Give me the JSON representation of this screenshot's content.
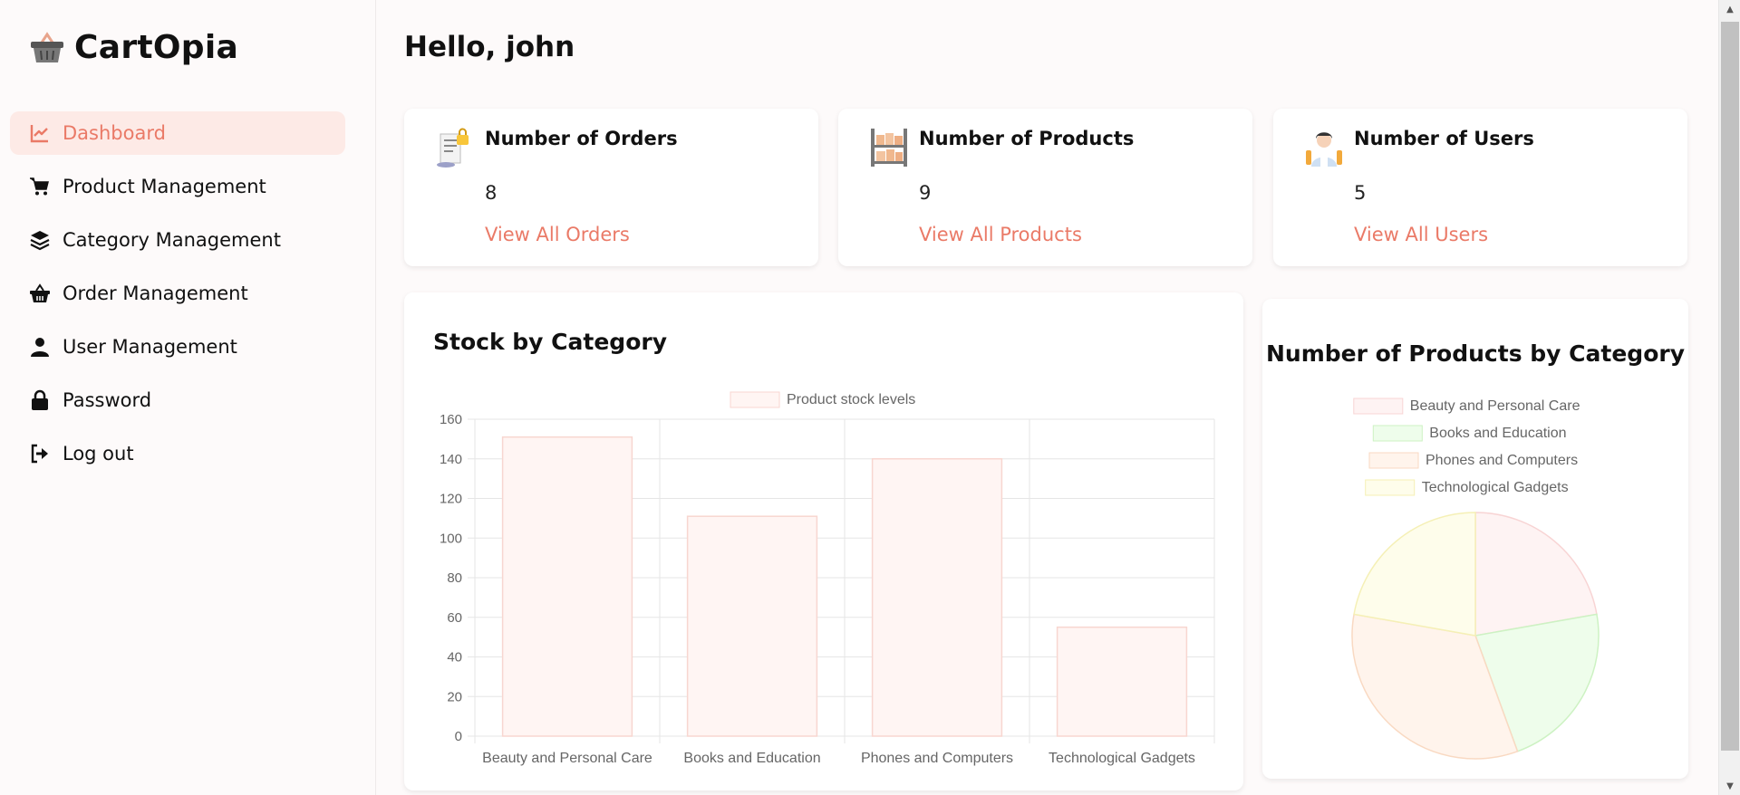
{
  "app": {
    "name": "CartOpia",
    "logo_icon": "basket-icon",
    "brand_color": "#ea7a67"
  },
  "sidebar": {
    "items": [
      {
        "label": "Dashboard",
        "icon": "chart-line-icon",
        "active": true
      },
      {
        "label": "Product Management",
        "icon": "cart-icon"
      },
      {
        "label": "Category Management",
        "icon": "layers-icon"
      },
      {
        "label": "Order Management",
        "icon": "basket-icon"
      },
      {
        "label": "User Management",
        "icon": "user-icon"
      },
      {
        "label": "Password",
        "icon": "lock-icon"
      },
      {
        "label": "Log out",
        "icon": "logout-icon"
      }
    ]
  },
  "header": {
    "greeting": "Hello, john"
  },
  "stats": [
    {
      "title": "Number of Orders",
      "value": "8",
      "link": "View All Orders",
      "icon": "order-receipt-icon"
    },
    {
      "title": "Number of Products",
      "value": "9",
      "link": "View All Products",
      "icon": "product-shelf-icon"
    },
    {
      "title": "Number of Users",
      "value": "5",
      "link": "View All Users",
      "icon": "users-icon"
    }
  ],
  "chart_data": [
    {
      "type": "bar",
      "title": "Stock by Category",
      "categories": [
        "Beauty and Personal Care",
        "Books and Education",
        "Phones and Computers",
        "Technological Gadgets"
      ],
      "series": [
        {
          "name": "Product stock levels",
          "values": [
            151,
            111,
            140,
            55
          ]
        }
      ],
      "ylim": [
        0,
        160
      ],
      "yticks": [
        0,
        20,
        40,
        60,
        80,
        100,
        120,
        140,
        160
      ],
      "grid": true,
      "legend": "top",
      "colors": {
        "fill": "#fff5f3",
        "stroke": "#f8d6d0"
      }
    },
    {
      "type": "pie",
      "title": "Number of Products by Category",
      "labels": [
        "Beauty and Personal Care",
        "Books and Education",
        "Phones and Computers",
        "Technological Gadgets"
      ],
      "values": [
        2,
        2,
        3,
        2
      ],
      "legend": "top",
      "colors": [
        {
          "fill": "#fef3f3",
          "stroke": "#f8d4d4"
        },
        {
          "fill": "#eefdeb",
          "stroke": "#cdf2c3"
        },
        {
          "fill": "#fff4ec",
          "stroke": "#f9d9c2"
        },
        {
          "fill": "#fefdeb",
          "stroke": "#f5f0b6"
        }
      ]
    }
  ]
}
